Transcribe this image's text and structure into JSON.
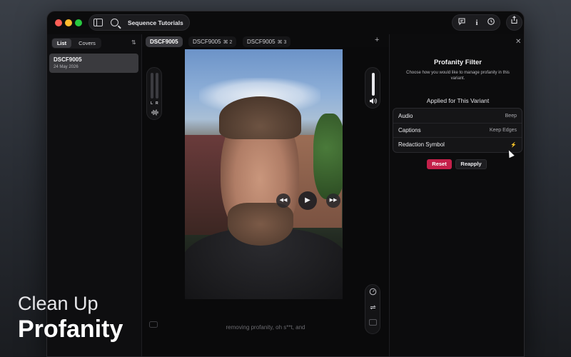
{
  "window": {
    "title": "Sequence Tutorials",
    "title_chevron": "⌄"
  },
  "toolbar": {
    "comment_icon": "speech-bubble",
    "info_icon": "info",
    "history_icon": "clock-history",
    "share_icon": "share"
  },
  "sidebar": {
    "segments": [
      "List",
      "Covers"
    ],
    "active_segment": "List",
    "sort_icon": "⇅",
    "items": [
      {
        "title": "DSCF9005",
        "date": "24 May 2026"
      }
    ]
  },
  "tabs": [
    {
      "label": "DSCF9005",
      "shortcut": "",
      "active": true
    },
    {
      "label": "DSCF9005",
      "shortcut": "⌘ 2",
      "active": false
    },
    {
      "label": "DSCF9005",
      "shortcut": "⌘ 3",
      "active": false
    }
  ],
  "add_tab": "+",
  "player": {
    "meter_left": "L",
    "meter_right": "R",
    "rewind_glyph": "◀◀",
    "play_glyph": "▶",
    "forward_glyph": "▶▶",
    "caption": "removing profanity, oh s**t, and"
  },
  "panel": {
    "close_glyph": "✕",
    "title": "Profanity Filter",
    "subtitle": "Choose how you would like to manage profanity in this variant.",
    "section_title": "Applied for This Variant",
    "options": [
      {
        "label": "Audio",
        "value": "Beep"
      },
      {
        "label": "Captions",
        "value": "Keep Edges"
      },
      {
        "label": "Redaction Symbol",
        "value": "⚡"
      }
    ],
    "reset_label": "Reset",
    "reapply_label": "Reapply",
    "accent": "#c4204a"
  },
  "promo": {
    "line1": "Clean Up",
    "line2": "Profanity"
  }
}
